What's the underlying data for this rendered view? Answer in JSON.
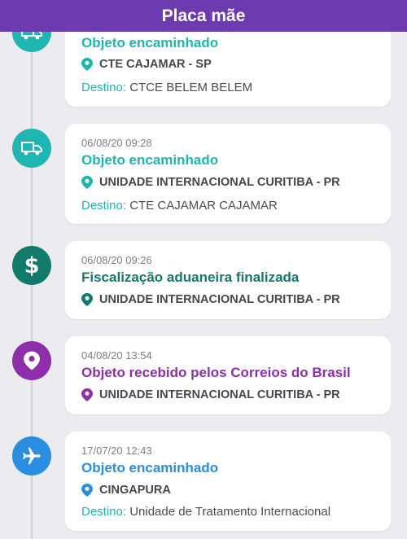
{
  "header": {
    "title": "Placa mãe"
  },
  "colors": {
    "header_bg": "#6c3bb0",
    "teal": "#1fb5b0",
    "green": "#117a6a",
    "purple": "#8d2eaa",
    "blue": "#2a8ee0"
  },
  "events": [
    {
      "icon": "truck-icon",
      "date": "",
      "status": "Objeto encaminhado",
      "location": "CTE CAJAMAR - SP",
      "destination_label": "Destino:",
      "destination": "CTCE BELEM BELEM"
    },
    {
      "icon": "truck-icon",
      "date": "06/08/20 09:28",
      "status": "Objeto encaminhado",
      "location": "UNIDADE INTERNACIONAL CURITIBA - PR",
      "destination_label": "Destino:",
      "destination": "CTE CAJAMAR CAJAMAR"
    },
    {
      "icon": "dollar-icon",
      "date": "06/08/20 09:26",
      "status": "Fiscalização aduaneira finalizada",
      "location": "UNIDADE INTERNACIONAL CURITIBA - PR"
    },
    {
      "icon": "location-pin-icon",
      "date": "04/08/20 13:54",
      "status": "Objeto recebido pelos Correios do Brasil",
      "location": "UNIDADE INTERNACIONAL CURITIBA - PR"
    },
    {
      "icon": "airplane-icon",
      "date": "17/07/20 12:43",
      "status": "Objeto encaminhado",
      "location": "CINGAPURA",
      "destination_label": "Destino:",
      "destination": "Unidade de Tratamento Internacional"
    }
  ]
}
